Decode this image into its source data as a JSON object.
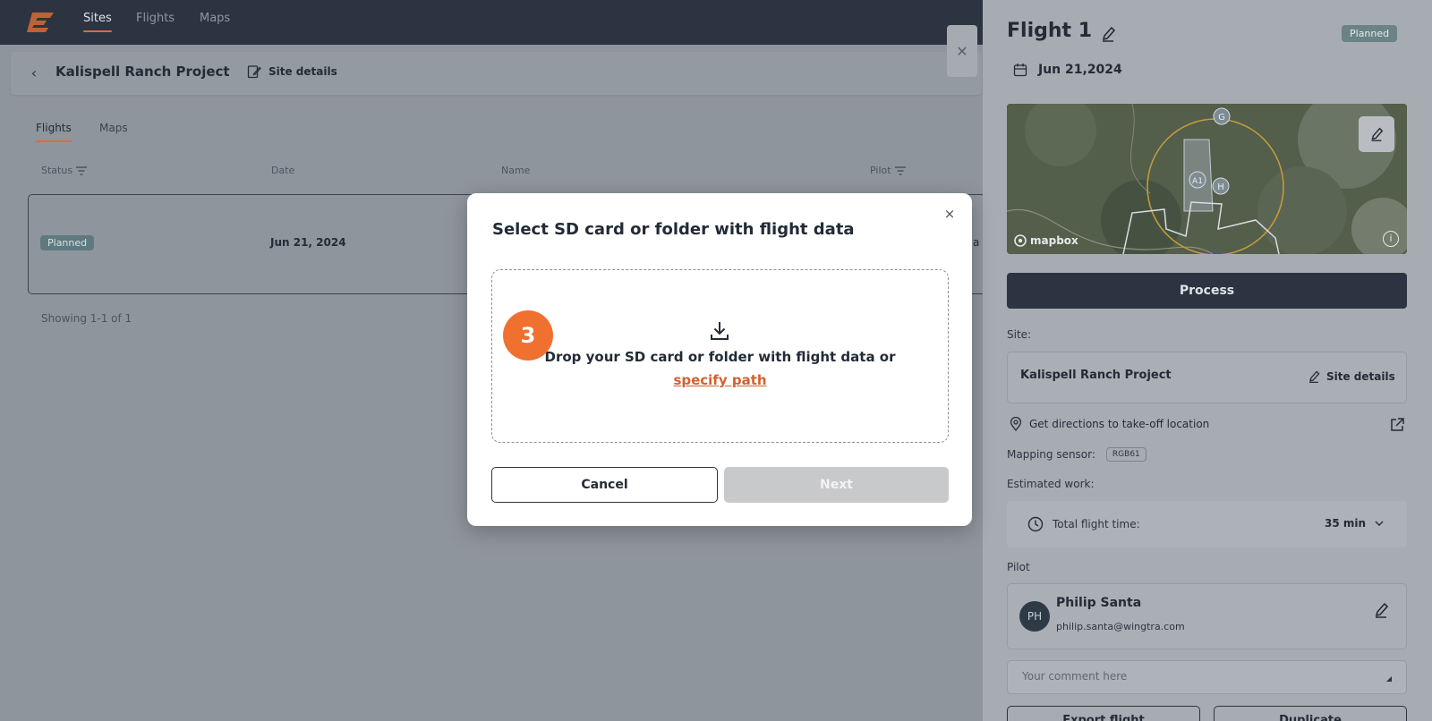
{
  "nav": {
    "items": [
      {
        "label": "Sites",
        "active": true
      },
      {
        "label": "Flights",
        "active": false
      },
      {
        "label": "Maps",
        "active": false
      }
    ]
  },
  "project": {
    "title": "Kalispell Ranch Project",
    "site_details_label": "Site details"
  },
  "tabs": [
    {
      "label": "Flights",
      "active": true
    },
    {
      "label": "Maps",
      "active": false
    }
  ],
  "table": {
    "columns": [
      "Status",
      "Date",
      "Name",
      "Pilot"
    ],
    "rows": [
      {
        "status": "Planned",
        "date": "Jun 21, 2024",
        "pilot_peek": "a"
      }
    ],
    "footer": "Showing 1-1 of 1"
  },
  "panel": {
    "title": "Flight 1",
    "status_badge": "Planned",
    "date": "Jun 21,2024",
    "map": {
      "markers": [
        "G",
        "A1",
        "H"
      ],
      "attribution": "mapbox",
      "info_glyph": "i"
    },
    "process_label": "Process",
    "site_label": "Site:",
    "site_name": "Kalispell Ranch Project",
    "site_details_label": "Site details",
    "directions_label": "Get directions to take-off location",
    "sensor_label": "Mapping sensor:",
    "sensor_value": "RGB61",
    "estimated_label": "Estimated work:",
    "flight_time_label": "Total flight time:",
    "flight_time_value": "35 min",
    "pilot_label": "Pilot",
    "pilot": {
      "initials": "PH",
      "name": "Philip Santa",
      "email": "philip.santa@wingtra.com"
    },
    "comment_placeholder": "Your comment here",
    "bottom_buttons": [
      "Export flight",
      "Duplicate"
    ]
  },
  "modal": {
    "title": "Select SD card or folder with flight data",
    "drop_text": "Drop your SD card or folder with flight data or",
    "drop_link": "specify path",
    "step_number": "3",
    "cancel_label": "Cancel",
    "next_label": "Next",
    "close_glyph": "×"
  },
  "colors": {
    "accent": "#e3683c",
    "step_badge": "#f0702f",
    "dark": "#2b3440",
    "overlay_bg": "#8f959c"
  }
}
